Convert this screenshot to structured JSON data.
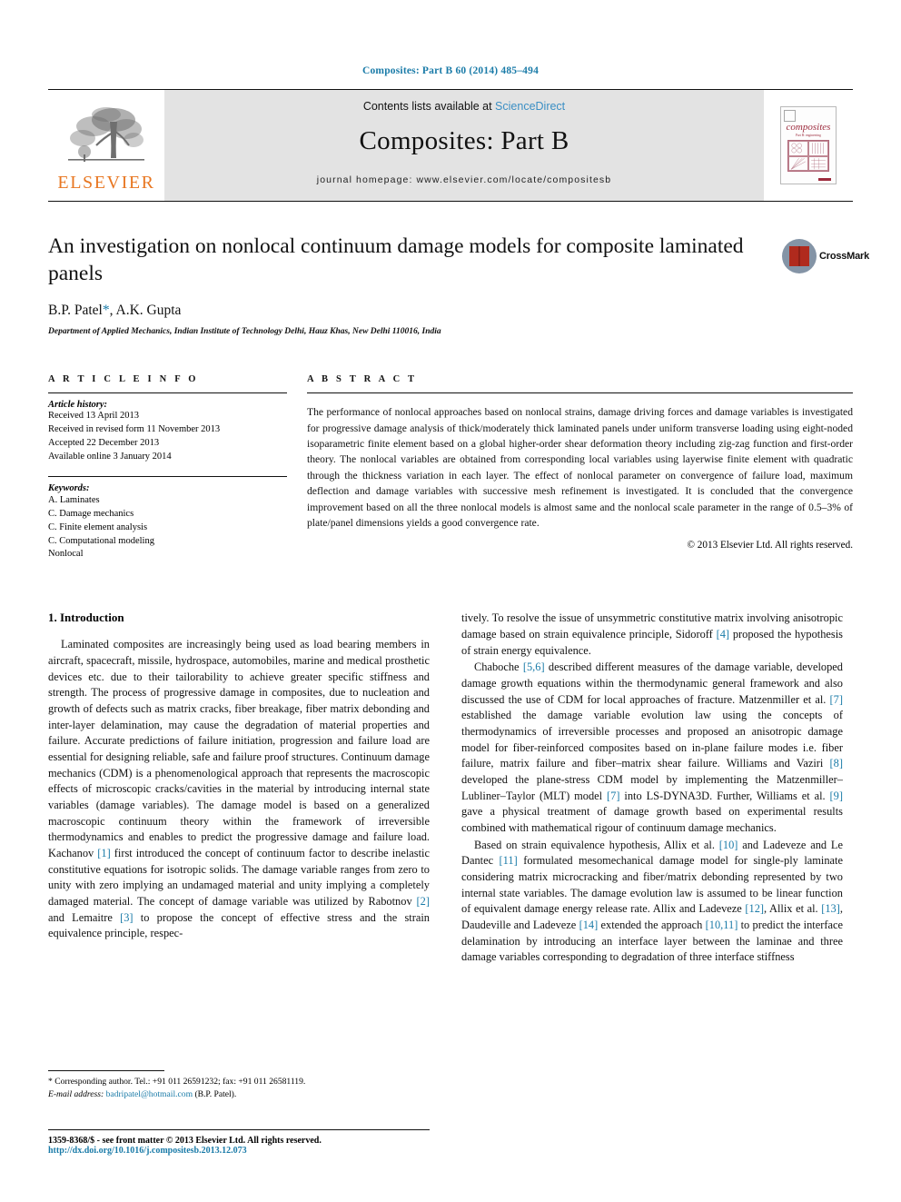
{
  "running_head": "Composites: Part B 60 (2014) 485–494",
  "masthead": {
    "contents_prefix": "Contents lists available at ",
    "sciencedirect": "ScienceDirect",
    "journal_name": "Composites: Part B",
    "homepage": "journal homepage: www.elsevier.com/locate/compositesb",
    "publisher_logo_text": "ELSEVIER",
    "cover_title": "composites",
    "cover_subtitle": "Part B: engineering"
  },
  "article": {
    "title": "An investigation on nonlocal continuum damage models for composite laminated panels",
    "authors_pre": "B.P. Patel",
    "authors_star": "*",
    "authors_post": ", A.K. Gupta",
    "affiliation": "Department of Applied Mechanics, Indian Institute of Technology Delhi, Hauz Khas, New Delhi 110016, India",
    "crossmark_label": "CrossMark"
  },
  "article_info": {
    "heading": "A R T I C L E   I N F O",
    "history_label": "Article history:",
    "history": [
      "Received 13 April 2013",
      "Received in revised form 11 November 2013",
      "Accepted 22 December 2013",
      "Available online 3 January 2014"
    ],
    "keywords_label": "Keywords:",
    "keywords": [
      "A. Laminates",
      "C. Damage mechanics",
      "C. Finite element analysis",
      "C. Computational modeling",
      "Nonlocal"
    ]
  },
  "abstract": {
    "heading": "A B S T R A C T",
    "text": "The performance of nonlocal approaches based on nonlocal strains, damage driving forces and damage variables is investigated for progressive damage analysis of thick/moderately thick laminated panels under uniform transverse loading using eight-noded isoparametric finite element based on a global higher-order shear deformation theory including zig-zag function and first-order theory. The nonlocal variables are obtained from corresponding local variables using layerwise finite element with quadratic through the thickness variation in each layer. The effect of nonlocal parameter on convergence of failure load, maximum deflection and damage variables with successive mesh refinement is investigated. It is concluded that the convergence improvement based on all the three nonlocal models is almost same and the nonlocal scale parameter in the range of 0.5–3% of plate/panel dimensions yields a good convergence rate.",
    "copyright": "© 2013 Elsevier Ltd. All rights reserved."
  },
  "body": {
    "section_title": "1. Introduction",
    "left_para_1_a": "Laminated composites are increasingly being used as load bearing members in aircraft, spacecraft, missile, hydrospace, automobiles, marine and medical prosthetic devices etc. due to their tailorability to achieve greater specific stiffness and strength. The process of progressive damage in composites, due to nucleation and growth of defects such as matrix cracks, fiber breakage, fiber matrix debonding and inter-layer delamination, may cause the degradation of material properties and failure. Accurate predictions of failure initiation, progression and failure load are essential for designing reliable, safe and failure proof structures. Continuum damage mechanics (CDM) is a phenomenological approach that represents the macroscopic effects of microscopic cracks/cavities in the material by introducing internal state variables (damage variables). The damage model is based on a generalized macroscopic continuum theory within the framework of irreversible thermodynamics and enables to predict the progressive damage and failure load. Kachanov ",
    "ref_1": "[1]",
    "left_para_1_b": " first introduced the concept of continuum factor to describe inelastic constitutive equations for isotropic solids. The damage variable ranges from zero to unity with zero implying an undamaged material and unity implying a completely damaged material. The concept of damage variable was utilized by Rabotnov ",
    "ref_2": "[2]",
    "left_para_1_c": " and Lemaitre ",
    "ref_3": "[3]",
    "left_para_1_d": " to propose the concept of effective stress and the strain equivalence principle, respec-",
    "right_para_1_a": "tively. To resolve the issue of unsymmetric constitutive matrix involving anisotropic damage based on strain equivalence principle, Sidoroff ",
    "ref_4": "[4]",
    "right_para_1_b": " proposed the hypothesis of strain energy equivalence.",
    "right_para_2_a": "Chaboche ",
    "ref_56": "[5,6]",
    "right_para_2_b": " described different measures of the damage variable, developed damage growth equations within the thermodynamic general framework and also discussed the use of CDM for local approaches of fracture. Matzenmiller et al. ",
    "ref_7": "[7]",
    "right_para_2_c": " established the damage variable evolution law using the concepts of thermodynamics of irreversible processes and proposed an anisotropic damage model for fiber-reinforced composites based on in-plane failure modes i.e. fiber failure, matrix failure and fiber–matrix shear failure. Williams and Vaziri ",
    "ref_8": "[8]",
    "right_para_2_d": " developed the plane-stress CDM model by implementing the Matzenmiller–Lubliner–Taylor (MLT) model ",
    "ref_7b": "[7]",
    "right_para_2_e": " into LS-DYNA3D. Further, Williams et al. ",
    "ref_9": "[9]",
    "right_para_2_f": " gave a physical treatment of damage growth based on experimental results combined with mathematical rigour of continuum damage mechanics.",
    "right_para_3_a": "Based on strain equivalence hypothesis, Allix et al. ",
    "ref_10": "[10]",
    "right_para_3_b": " and Ladeveze and Le Dantec ",
    "ref_11": "[11]",
    "right_para_3_c": " formulated mesomechanical damage model for single-ply laminate considering matrix microcracking and fiber/matrix debonding represented by two internal state variables. The damage evolution law is assumed to be linear function of equivalent damage energy release rate. Allix and Ladeveze ",
    "ref_12": "[12]",
    "right_para_3_d": ", Allix et al. ",
    "ref_13": "[13]",
    "right_para_3_e": ", Daudeville and Ladeveze ",
    "ref_14": "[14]",
    "right_para_3_f": " extended the approach ",
    "ref_1011": "[10,11]",
    "right_para_3_g": " to predict the interface delamination by introducing an interface layer between the laminae and three damage variables corresponding to degradation of three interface stiffness"
  },
  "footnote": {
    "corresponding": "* Corresponding author. Tel.: +91 011 26591232; fax: +91 011 26581119.",
    "email_label": "E-mail address:",
    "email": "badripatel@hotmail.com",
    "email_suffix": "(B.P. Patel)."
  },
  "bottom": {
    "issn_line": "1359-8368/$ - see front matter © 2013 Elsevier Ltd. All rights reserved.",
    "doi": "http://dx.doi.org/10.1016/j.compositesb.2013.12.073"
  },
  "colors": {
    "link": "#1a7ba8",
    "elsevier_orange": "#E87722",
    "cover_red": "#9d2b3d",
    "masthead_grey": "#e3e3e3"
  }
}
